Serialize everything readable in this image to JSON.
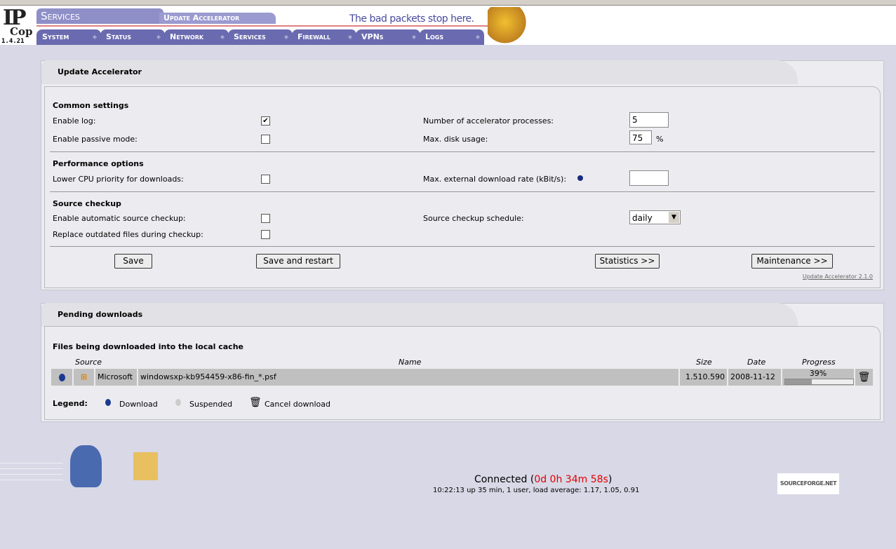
{
  "header": {
    "logo": "IPCop",
    "version": "1.4.21",
    "section": "Services",
    "subsection": "Update Accelerator",
    "slogan": "The bad packets stop here.",
    "nav": [
      "System",
      "Status",
      "Network",
      "Services",
      "Firewall",
      "VPNs",
      "Logs"
    ]
  },
  "settings": {
    "title": "Update Accelerator",
    "common_heading": "Common settings",
    "enable_log": "Enable log:",
    "enable_log_checked": true,
    "passive_mode": "Enable passive mode:",
    "passive_mode_checked": false,
    "processes_label": "Number of accelerator processes:",
    "processes_value": "5",
    "disk_label": "Max. disk usage:",
    "disk_value": "75",
    "disk_unit": "%",
    "perf_heading": "Performance options",
    "lower_cpu": "Lower CPU priority for downloads:",
    "lower_cpu_checked": false,
    "rate_label": "Max. external download rate (kBit/s):",
    "rate_value": "",
    "source_heading": "Source checkup",
    "auto_checkup": "Enable automatic source checkup:",
    "auto_checkup_checked": false,
    "replace_outdated": "Replace outdated files during checkup:",
    "replace_outdated_checked": false,
    "schedule_label": "Source checkup schedule:",
    "schedule_value": "daily",
    "buttons": {
      "save": "Save",
      "save_restart": "Save and restart",
      "statistics": "Statistics >>",
      "maintenance": "Maintenance >>"
    },
    "version_link": "Update Accelerator 2.1.0"
  },
  "pending": {
    "title": "Pending downloads",
    "subtitle": "Files being downloaded into the local cache",
    "columns": {
      "source": "Source",
      "name": "Name",
      "size": "Size",
      "date": "Date",
      "progress": "Progress"
    },
    "rows": [
      {
        "source": "Microsoft",
        "name": "windowsxp-kb954459-x86-fin_*.psf",
        "size": "1.510.590",
        "date": "2008-11-12",
        "progress_label": "39%",
        "progress": 0.39
      }
    ],
    "legend": {
      "label": "Legend:",
      "download": "Download",
      "suspended": "Suspended",
      "cancel": "Cancel download"
    }
  },
  "footer": {
    "connected": "Connected",
    "uptime_paren_open": "(",
    "uptime": "0d 0h 34m 58s",
    "uptime_paren_close": ")",
    "status_line": "10:22:13 up 35 min, 1 user, load average: 1.17, 1.05, 0.91",
    "sourceforge": "SOURCEFORGE.NET"
  }
}
